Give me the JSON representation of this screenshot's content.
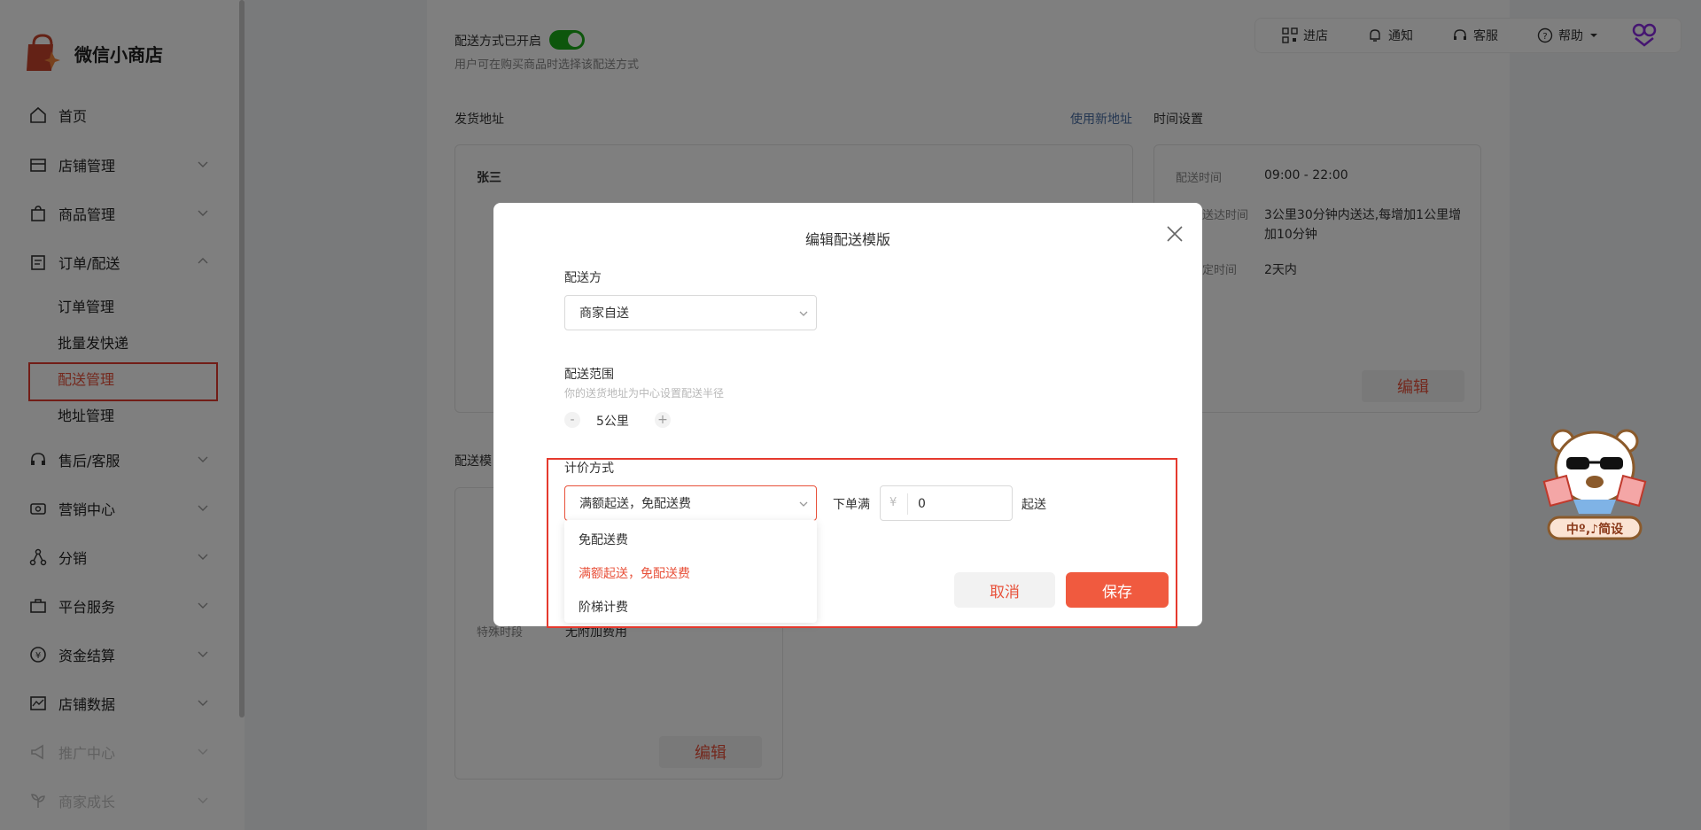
{
  "app": {
    "title": "微信小商店"
  },
  "sidebar": {
    "items": [
      {
        "label": "首页"
      },
      {
        "label": "店铺管理"
      },
      {
        "label": "商品管理"
      },
      {
        "label": "订单/配送"
      },
      {
        "label": "售后/客服"
      },
      {
        "label": "营销中心"
      },
      {
        "label": "分销"
      },
      {
        "label": "平台服务"
      },
      {
        "label": "资金结算"
      },
      {
        "label": "店铺数据"
      },
      {
        "label": "推广中心"
      },
      {
        "label": "商家成长"
      }
    ],
    "subitems": [
      {
        "label": "订单管理"
      },
      {
        "label": "批量发快递"
      },
      {
        "label": "配送管理"
      },
      {
        "label": "地址管理"
      }
    ]
  },
  "topbar": {
    "enter_store": "进店",
    "notify": "通知",
    "service": "客服",
    "help": "帮助"
  },
  "background": {
    "delivery_enabled": "配送方式已开启",
    "delivery_hint": "用户可在购买商品时选择该配送方式",
    "ship_address_title": "发货地址",
    "use_new_address": "使用新地址",
    "time_settings": "时间设置",
    "contact_name": "张三",
    "delivery_time_label": "配送时间",
    "delivery_time_value": "09:00 - 22:00",
    "arrival_time_label": "送达时间",
    "arrival_time_value": "3公里30分钟内送达,每增加1公里增加10分钟",
    "booking_time_label": "定时间",
    "booking_time_value": "2天内",
    "template_title": "配送模",
    "special_period": "特殊时段",
    "special_value": "无附加费用",
    "edit": "编辑"
  },
  "modal": {
    "title": "编辑配送模版",
    "party_label": "配送方",
    "party_value": "商家自送",
    "range_label": "配送范围",
    "range_hint": "你的送货地址为中心设置配送半径",
    "range_value": "5公里",
    "minus": "-",
    "plus": "+",
    "pricing_label": "计价方式",
    "pricing_value": "满额起送，免配送费",
    "min_order_label": "下单满",
    "currency": "¥",
    "min_order_value": "0",
    "start_label": "起送",
    "options": [
      "免配送费",
      "满额起送，免配送费",
      "阶梯计费"
    ],
    "cancel": "取消",
    "save": "保存"
  },
  "mascot": {
    "text": "中º,♪简设"
  },
  "colors": {
    "accent": "#e8513a",
    "toggle": "#1aad19",
    "highlight": "#e53a2e"
  }
}
